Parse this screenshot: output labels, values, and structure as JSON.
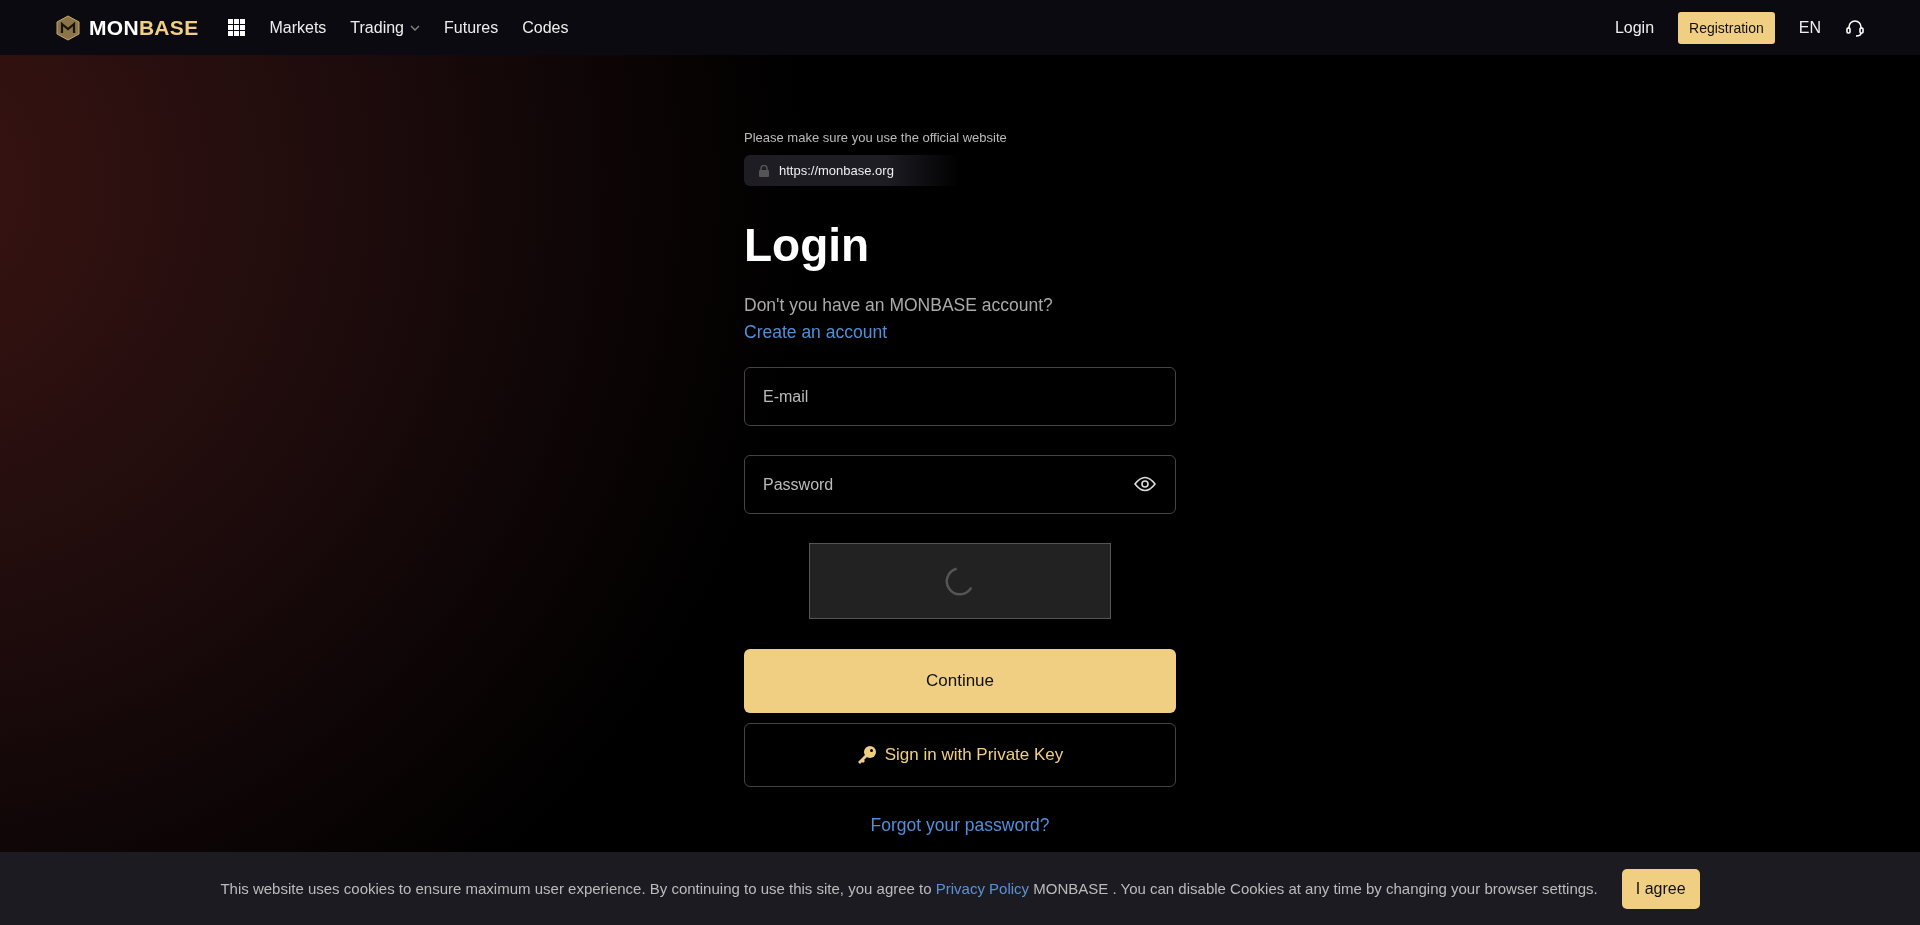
{
  "header": {
    "logo": {
      "first": "MON",
      "second": "BASE"
    },
    "nav": [
      {
        "label": "Markets",
        "has_menu": false
      },
      {
        "label": "Trading",
        "has_menu": true
      },
      {
        "label": "Futures",
        "has_menu": false
      },
      {
        "label": "Codes",
        "has_menu": false
      }
    ],
    "login": "Login",
    "registration": "Registration",
    "language": "EN"
  },
  "form": {
    "notice": "Please make sure you use the official website",
    "url": "https://monbase.org",
    "title": "Login",
    "prompt": "Don't you have an MONBASE account?",
    "signup_link": "Create an account",
    "email": {
      "placeholder": "E-mail"
    },
    "password": {
      "placeholder": "Password"
    },
    "continue": "Continue",
    "private_key": "Sign in with Private Key",
    "forgot": "Forgot your password?"
  },
  "cookie": {
    "before": "This website uses cookies to ensure maximum user experience. By continuing to use this site, you agree to",
    "link": "Privacy Policy",
    "after": "MONBASE . You can disable Cookies at any time by changing your browser settings.",
    "agree": "I agree"
  }
}
